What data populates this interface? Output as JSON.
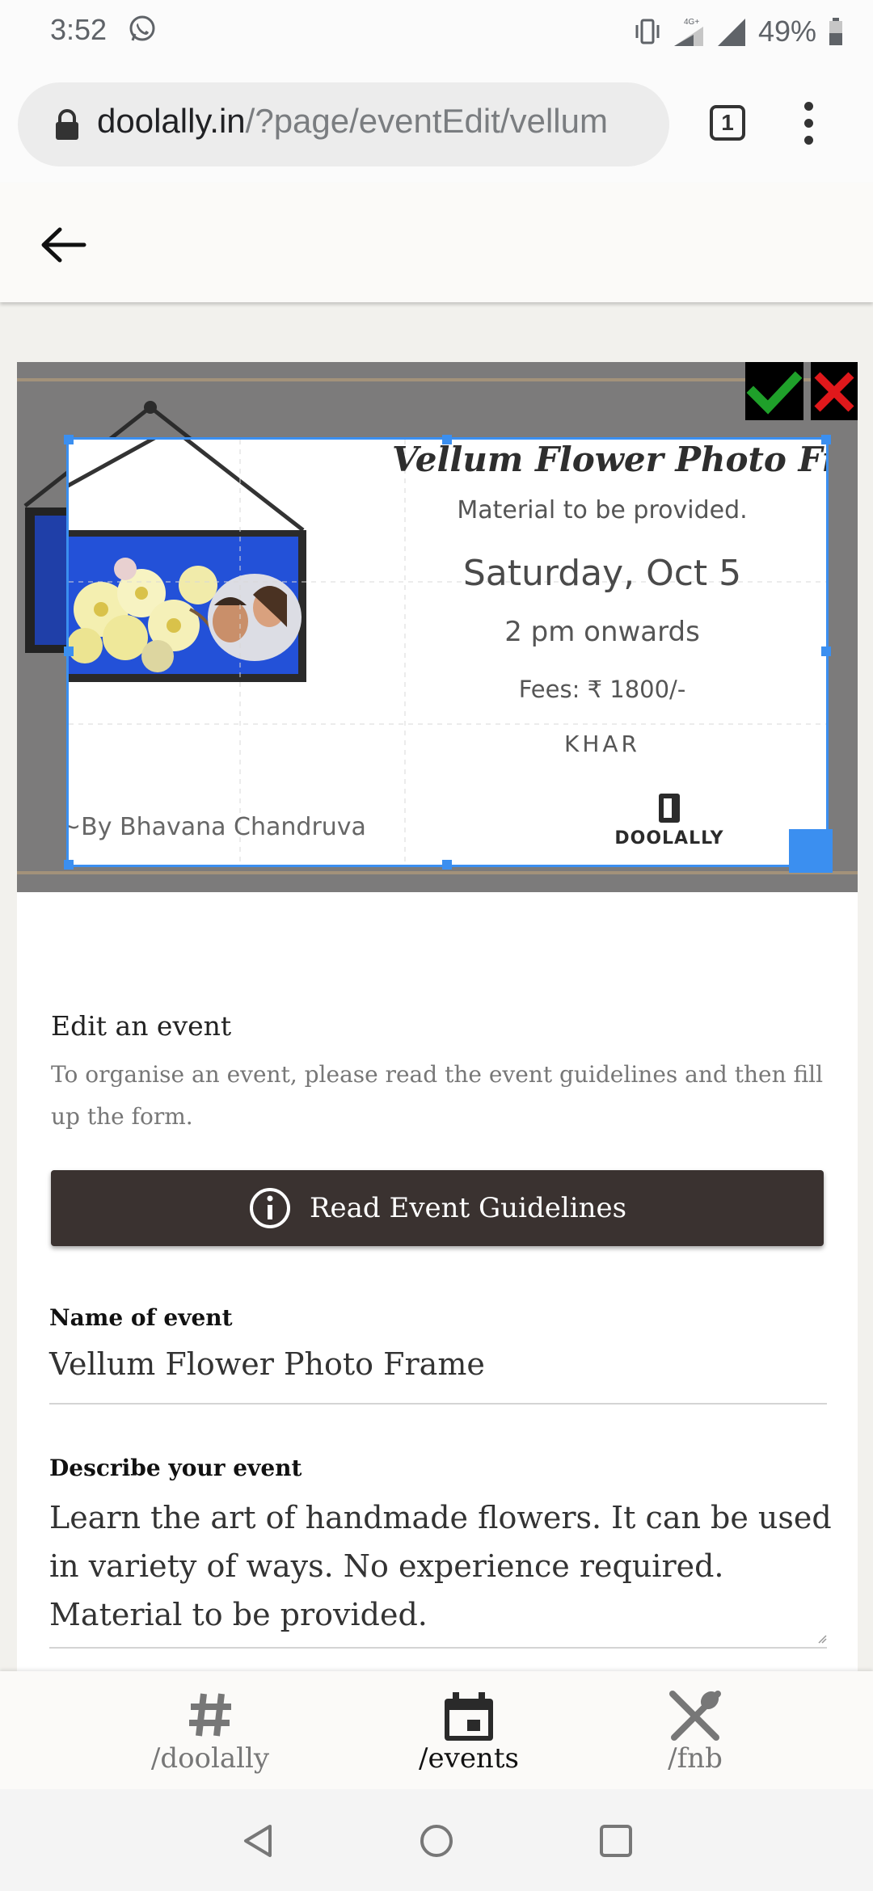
{
  "status_bar": {
    "time": "3:52",
    "network": "4G+",
    "battery": "49%"
  },
  "browser": {
    "url_host": "doolally.in",
    "url_path": "/?page/eventEdit/vellum",
    "tab_count": "1"
  },
  "poster": {
    "title": "Vellum Flower Photo Frame",
    "line1": "Material to be provided.",
    "date": "Saturday, Oct 5",
    "time": "2 pm onwards",
    "fees": "Fees: ₹ 1800/-",
    "location": "KHAR",
    "byline": "~By Bhavana Chandruva",
    "logo_text": "DOOLALLY"
  },
  "form": {
    "heading": "Edit an event",
    "subheading": "To organise an event, please read the event guidelines and then fill up the form.",
    "guidelines_button": "Read Event Guidelines",
    "name_label": "Name of event",
    "name_value": "Vellum Flower Photo Frame",
    "desc_label": "Describe your event",
    "desc_value": "Learn the art of handmade flowers. It can be used in variety of ways. No experience required. Material to be provided."
  },
  "bottom_nav": {
    "items": [
      {
        "label": "/doolally",
        "icon": "hash-icon",
        "active": false
      },
      {
        "label": "/events",
        "icon": "calendar-icon",
        "active": true
      },
      {
        "label": "/fnb",
        "icon": "utensils-icon",
        "active": false
      }
    ]
  },
  "colors": {
    "accent": "#3b8ff0",
    "button_dark": "#3a3230",
    "confirm_green": "#1fa02a",
    "cancel_red": "#e0181b"
  }
}
